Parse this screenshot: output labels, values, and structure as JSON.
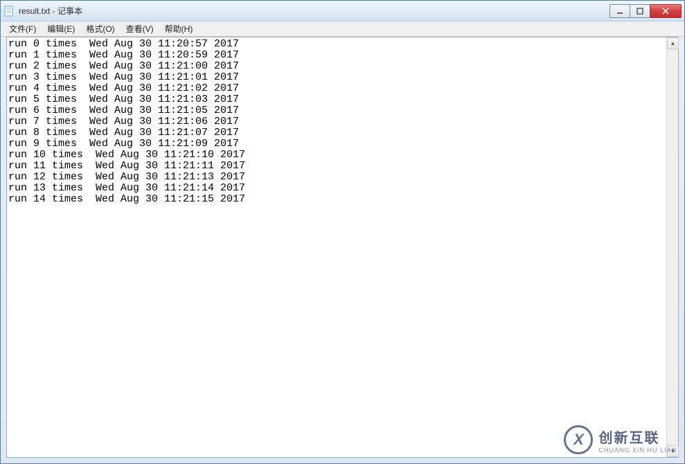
{
  "window": {
    "title": "result.txt - 记事本"
  },
  "menu": {
    "file": "文件(F)",
    "edit": "编辑(E)",
    "format": "格式(O)",
    "view": "查看(V)",
    "help": "帮助(H)"
  },
  "content": {
    "lines": [
      "run 0 times  Wed Aug 30 11:20:57 2017",
      "run 1 times  Wed Aug 30 11:20:59 2017",
      "run 2 times  Wed Aug 30 11:21:00 2017",
      "run 3 times  Wed Aug 30 11:21:01 2017",
      "run 4 times  Wed Aug 30 11:21:02 2017",
      "run 5 times  Wed Aug 30 11:21:03 2017",
      "run 6 times  Wed Aug 30 11:21:05 2017",
      "run 7 times  Wed Aug 30 11:21:06 2017",
      "run 8 times  Wed Aug 30 11:21:07 2017",
      "run 9 times  Wed Aug 30 11:21:09 2017",
      "run 10 times  Wed Aug 30 11:21:10 2017",
      "run 11 times  Wed Aug 30 11:21:11 2017",
      "run 12 times  Wed Aug 30 11:21:13 2017",
      "run 13 times  Wed Aug 30 11:21:14 2017",
      "run 14 times  Wed Aug 30 11:21:15 2017"
    ]
  },
  "watermark": {
    "logo_letter": "X",
    "cn": "创新互联",
    "en": "CHUANG XIN HU LIAN"
  }
}
